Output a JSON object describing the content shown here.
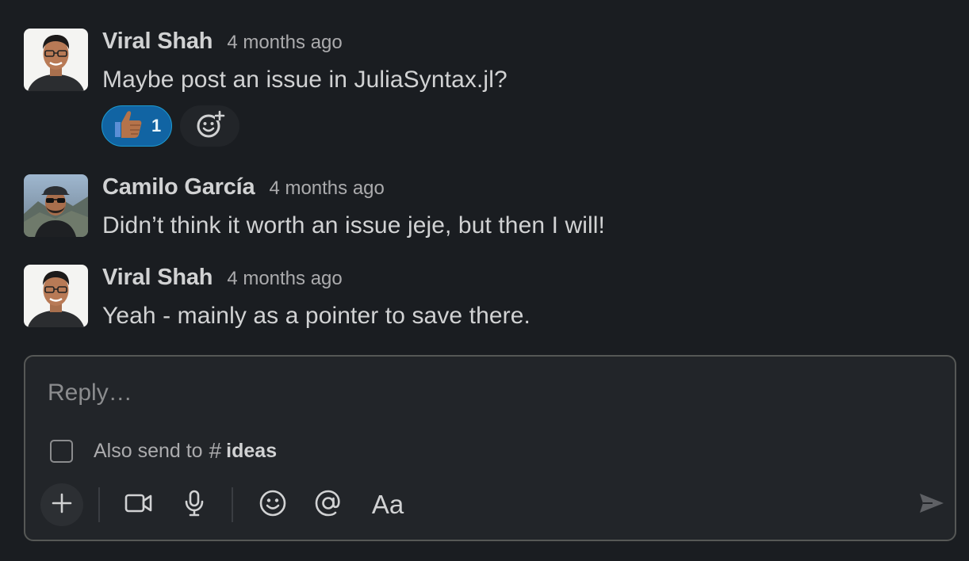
{
  "messages": [
    {
      "author": "Viral Shah",
      "time": "4 months ago",
      "text": "Maybe post an issue in JuliaSyntax.jl?",
      "avatar": "viral-shah-avatar",
      "reactions": [
        {
          "emoji": "thumbs-up-icon",
          "count": "1",
          "active": true
        }
      ]
    },
    {
      "author": "Camilo García",
      "time": "4 months ago",
      "text": "Didn’t think it worth an issue jeje, but then I will!",
      "avatar": "camilo-garcia-avatar"
    },
    {
      "author": "Viral Shah",
      "time": "4 months ago",
      "text": "Yeah - mainly as a pointer to save there.",
      "avatar": "viral-shah-avatar"
    }
  ],
  "composer": {
    "placeholder": "Reply…",
    "value": "",
    "also_send_label": "Also send to",
    "channel_hash": "#",
    "channel": "ideas",
    "also_send_checked": false,
    "format_label": "Aa",
    "toolbar_icons": [
      "plus-icon",
      "video-icon",
      "microphone-icon",
      "emoji-icon",
      "at-mention-icon",
      "text-format-icon",
      "send-icon"
    ]
  },
  "colors": {
    "background": "#1a1d21",
    "composer_bg": "#222529",
    "reaction_active": "#1164a3",
    "text": "#d1d2d3",
    "muted": "#ababad"
  }
}
